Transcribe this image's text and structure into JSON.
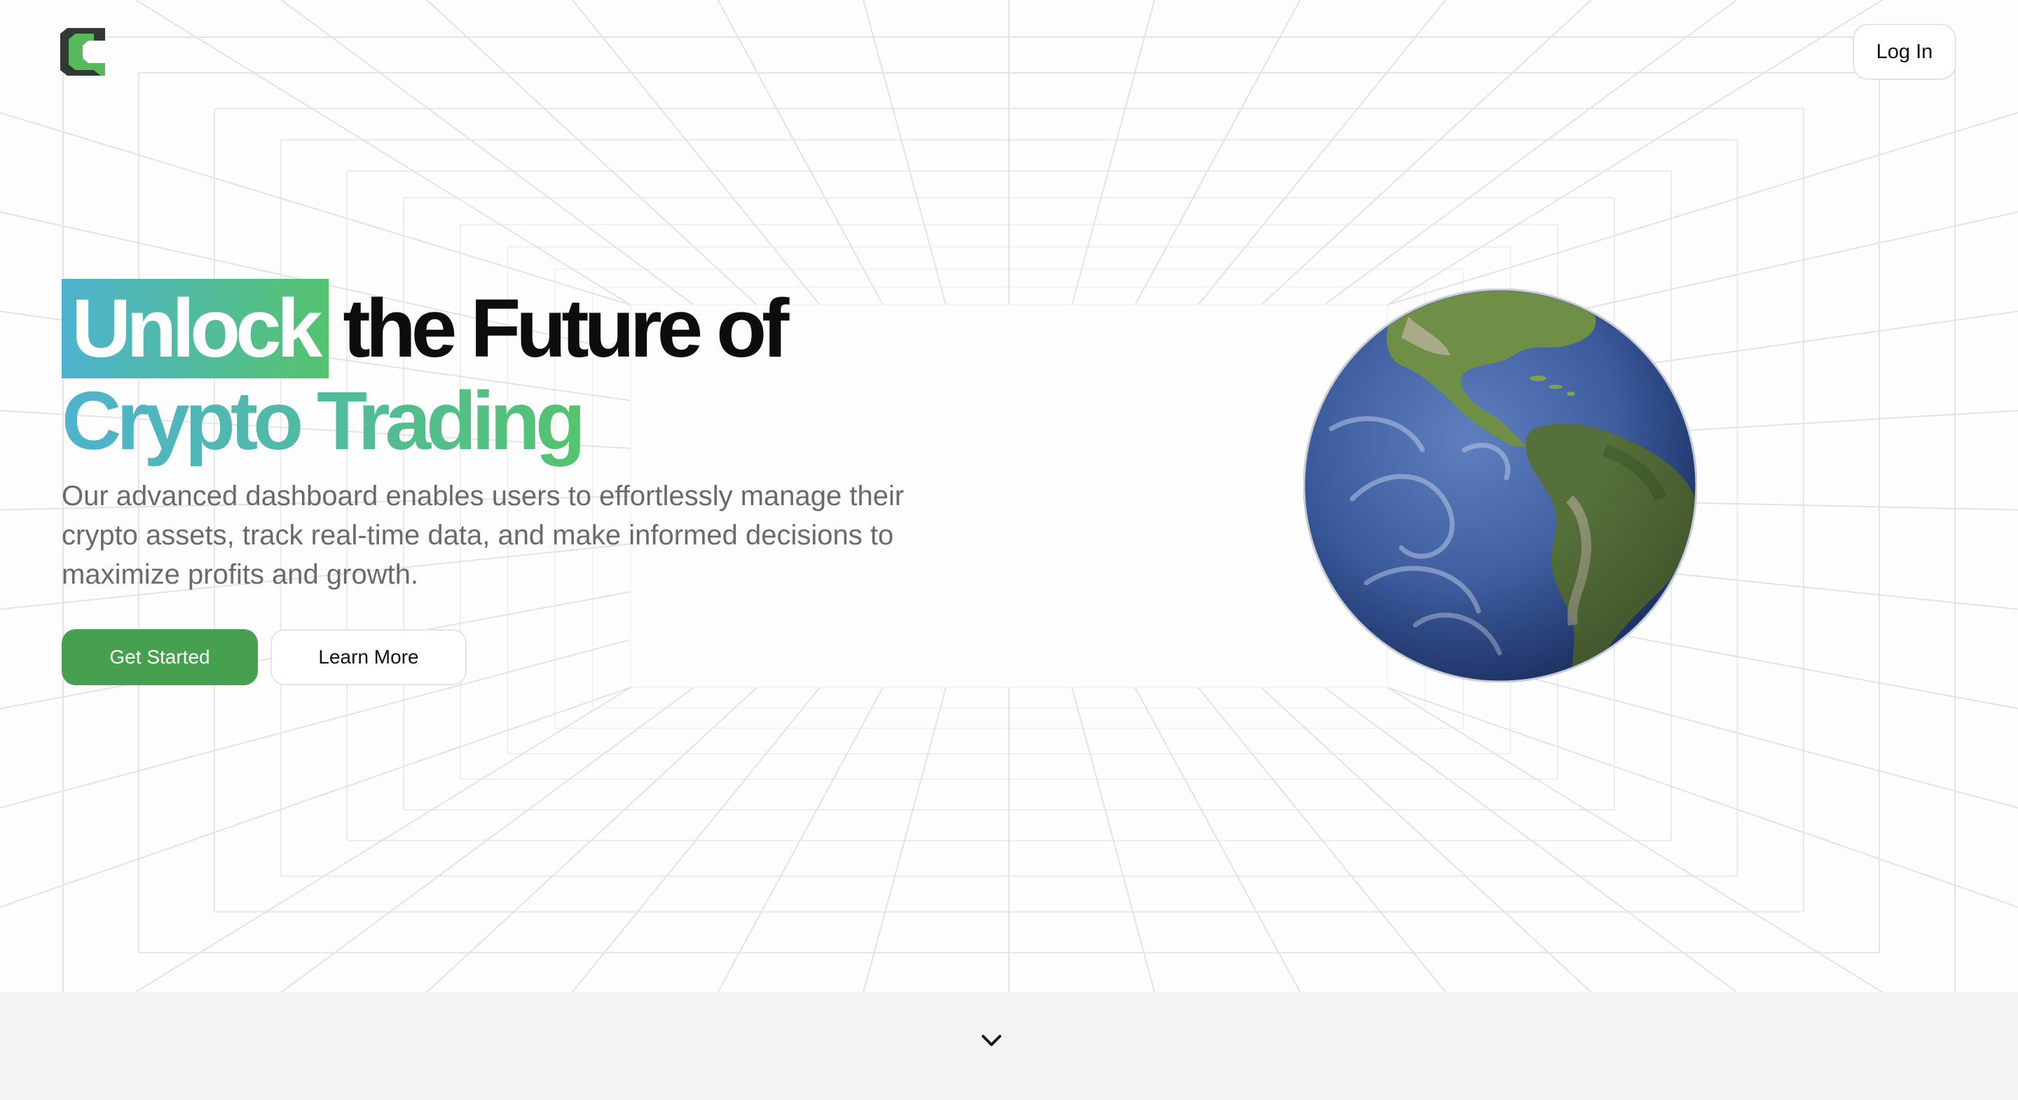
{
  "header": {
    "logo_icon": "brand-c-logo",
    "login_label": "Log In"
  },
  "hero": {
    "headline_highlight": "Unlock",
    "headline_rest": "the Future of",
    "headline_line2": "Crypto Trading",
    "description": "Our advanced dashboard enables users to effortlessly manage their crypto assets, track real-time data, and make informed decisions to maximize profits and growth.",
    "primary_cta": "Get Started",
    "secondary_cta": "Learn More",
    "image_icon": "earth-globe"
  },
  "footer": {
    "scroll_icon": "chevron-down-icon"
  },
  "colors": {
    "accent_green": "#46a04f",
    "gradient_start": "#4db3cf",
    "gradient_end": "#55c36f",
    "text_dark": "#0d0d0d",
    "text_muted": "#6a6a6a"
  }
}
